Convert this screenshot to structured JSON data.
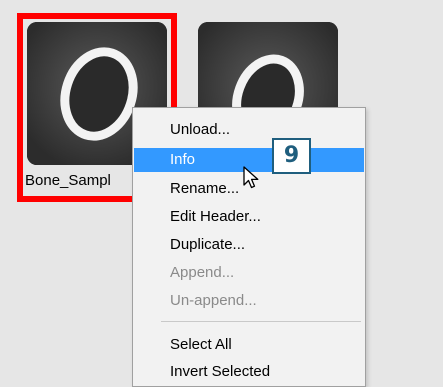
{
  "thumbnails": [
    {
      "label": "Bone_Sampl",
      "selected": true
    },
    {
      "label": "",
      "selected": false
    }
  ],
  "context_menu": {
    "items": [
      {
        "label": "Unload...",
        "enabled": true,
        "highlighted": false
      },
      {
        "label": "Info",
        "enabled": true,
        "highlighted": true
      },
      {
        "label": "Rename...",
        "enabled": true,
        "highlighted": false
      },
      {
        "label": "Edit Header...",
        "enabled": true,
        "highlighted": false
      },
      {
        "label": "Duplicate...",
        "enabled": true,
        "highlighted": false
      },
      {
        "label": "Append...",
        "enabled": false,
        "highlighted": false
      },
      {
        "label": "Un-append...",
        "enabled": false,
        "highlighted": false
      },
      {
        "label": "Select All",
        "enabled": true,
        "highlighted": false
      },
      {
        "label": "Invert Selected",
        "enabled": true,
        "highlighted": false
      }
    ]
  },
  "step_badge": {
    "number": "9"
  },
  "colors": {
    "selection": "#ff0000",
    "highlight": "#3399ff",
    "badge": "#1f5e7e",
    "background": "#e6e6e6"
  },
  "icons": {
    "cursor": "mouse-pointer-icon"
  }
}
